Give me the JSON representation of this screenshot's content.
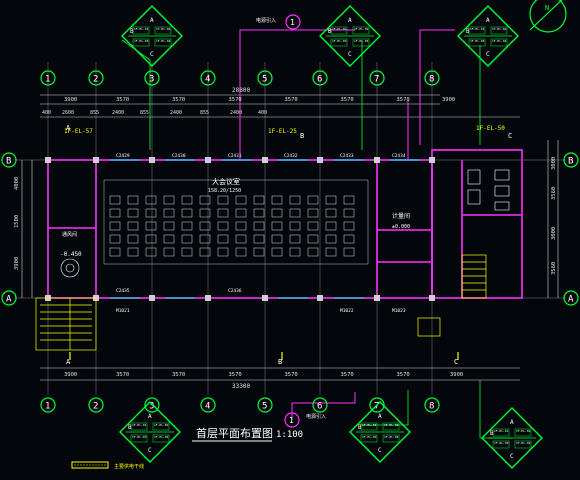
{
  "drawing": {
    "title": "首层平面布置图",
    "scale": "1:100",
    "hall_label": "大会议室",
    "hall_area": "158.20/1250",
    "room_label_1": "计量间",
    "room_label_2": "通风间",
    "elev_outside": "-0.450",
    "elev_outside_right": "±0.000",
    "legend_note": "主要供电干线",
    "north_label": "N"
  },
  "grid_columns": [
    "1",
    "2",
    "3",
    "4",
    "5",
    "6",
    "7",
    "8"
  ],
  "grid_rows": [
    "A",
    "B"
  ],
  "grid_rows_right": [
    "B",
    "A"
  ],
  "section_marks": [
    "A",
    "A",
    "B",
    "B",
    "C",
    "C"
  ],
  "top_dims_row1": [
    "3900",
    "3570",
    "3570",
    "3570",
    "3570",
    "3570",
    "3570",
    "3900"
  ],
  "top_overall": "28800",
  "top_dims_row2": [
    "400",
    "2600",
    "855",
    "2400",
    "855",
    "2400",
    "855",
    "2400",
    "400"
  ],
  "bottom_dims_row1": [
    "3900",
    "3570",
    "3570",
    "3570",
    "3570",
    "3570",
    "3570",
    "3900"
  ],
  "bottom_overall": "33300",
  "left_dims": [
    "4000",
    "1500",
    "3900"
  ],
  "right_dims": [
    "3000",
    "3560",
    "3000",
    "3560"
  ],
  "panel_tags_top": [
    "1F-EL-57",
    "1F-EL-25",
    "1F-EL-50"
  ],
  "equipment_codes": [
    "C2429",
    "C2430",
    "C2431",
    "C2432",
    "C2433",
    "C2434",
    "C2435",
    "C2436",
    "M1021",
    "M1022",
    "M1023"
  ],
  "callout_circle": "1",
  "callout_circle_bottom": "1",
  "callout_text_top": "电源引入",
  "callout_text_bottom": "电源引入",
  "diamond_top_letters": [
    "A",
    "B",
    "C"
  ],
  "diamond_labels": [
    "1F-EL-01",
    "1F-EL-02",
    "1F-EL-03",
    "1F-EL-04"
  ],
  "colors": {
    "bg": "#03060a",
    "wall": "#ff30ff",
    "dim": "#e0e0e0",
    "grid_bubble": "#00ff33",
    "accent_yellow": "#ffff00",
    "cyan": "#00ffff",
    "red": "#ff3030",
    "white": "#ffffff"
  }
}
